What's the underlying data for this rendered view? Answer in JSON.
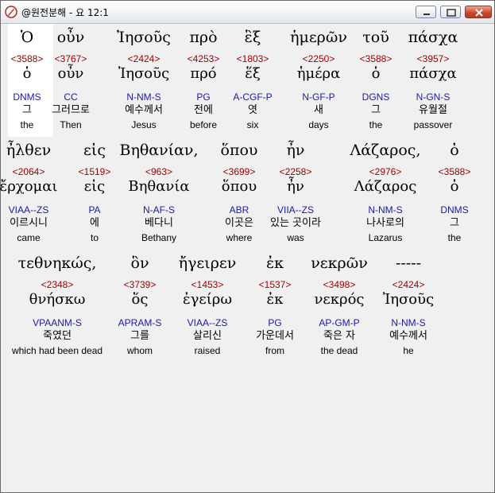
{
  "window": {
    "title": "@원전분해 - 요 12:1",
    "icon": "app-pen-icon"
  },
  "rows": [
    {
      "words": [
        {
          "greek": "Ὁ",
          "num": "<3588>",
          "lemma": "ὁ",
          "parse": "DNMS",
          "ko": "그",
          "en": "the"
        },
        {
          "greek": "οὖν",
          "num": "<3767>",
          "lemma": "οὖν",
          "parse": "CC",
          "ko": "그러므로",
          "en": "Then"
        },
        {
          "greek": "Ἰησοῦς",
          "num": "<2424>",
          "lemma": "Ἰησοῦς",
          "parse": "N-NM-S",
          "ko": "예수께서",
          "en": "Jesus"
        },
        {
          "greek": "πρὸ",
          "num": "<4253>",
          "lemma": "πρό",
          "parse": "PG",
          "ko": "전에",
          "en": "before"
        },
        {
          "greek": "ἓξ",
          "num": "<1803>",
          "lemma": "ἕξ",
          "parse": "A-CGF-P",
          "ko": "엿",
          "en": "six"
        },
        {
          "greek": "ἡμερῶν",
          "num": "<2250>",
          "lemma": "ἡμέρα",
          "parse": "N-GF-P",
          "ko": "새",
          "en": "days"
        },
        {
          "greek": "τοῦ",
          "num": "<3588>",
          "lemma": "ὁ",
          "parse": "DGNS",
          "ko": "그",
          "en": "the"
        },
        {
          "greek": "πάσχα",
          "num": "<3957>",
          "lemma": "πάσχα",
          "parse": "N-GN-S",
          "ko": "유월절",
          "en": "passover"
        }
      ]
    },
    {
      "words": [
        {
          "greek": "ἦλθεν",
          "num": "<2064>",
          "lemma": "ἔρχομαι",
          "parse": "VIAA--ZS",
          "ko": "이르시니",
          "en": "came"
        },
        {
          "greek": "εἰς",
          "num": "<1519>",
          "lemma": "εἰς",
          "parse": "PA",
          "ko": "에",
          "en": "to"
        },
        {
          "greek": "Βηθανίαν,",
          "num": "<963>",
          "lemma": "Βηθανία",
          "parse": "N-AF-S",
          "ko": "베다니",
          "en": "Bethany"
        },
        {
          "greek": "ὅπου",
          "num": "<3699>",
          "lemma": "ὅπου",
          "parse": "ABR",
          "ko": "이곳은",
          "en": "where"
        },
        {
          "greek": "ἦν",
          "num": "<2258>",
          "lemma": "ἦν",
          "parse": "VIIA--ZS",
          "ko": "있는 곳이라",
          "en": "was"
        },
        {
          "greek": "Λάζαρος,",
          "num": "<2976>",
          "lemma": "Λάζαρος",
          "parse": "N-NM-S",
          "ko": "나사로의",
          "en": "Lazarus"
        },
        {
          "greek": "ὁ",
          "num": "<3588>",
          "lemma": "ὁ",
          "parse": "DNMS",
          "ko": "그",
          "en": "the"
        }
      ]
    },
    {
      "words": [
        {
          "greek": "τεθνηκώς,",
          "num": "<2348>",
          "lemma": "θνήσκω",
          "parse": "VPAANM-S",
          "ko": "죽였던",
          "en": "which had been dead"
        },
        {
          "greek": "ὃν",
          "num": "<3739>",
          "lemma": "ὅς",
          "parse": "APRAM-S",
          "ko": "그를",
          "en": "whom"
        },
        {
          "greek": "ἤγειρεν",
          "num": "<1453>",
          "lemma": "ἐγείρω",
          "parse": "VIAA--ZS",
          "ko": "살리신",
          "en": "raised"
        },
        {
          "greek": "ἐκ",
          "num": "<1537>",
          "lemma": "ἐκ",
          "parse": "PG",
          "ko": "가운데서",
          "en": "from"
        },
        {
          "greek": "νεκρῶν",
          "num": "<3498>",
          "lemma": "νεκρός",
          "parse": "AP-GM-P",
          "ko": "죽은 자",
          "en": "the dead"
        },
        {
          "greek": "-----",
          "num": "<2424>",
          "lemma": "Ἰησοῦς",
          "parse": "N-NM-S",
          "ko": "예수께서",
          "en": "he"
        }
      ]
    }
  ]
}
